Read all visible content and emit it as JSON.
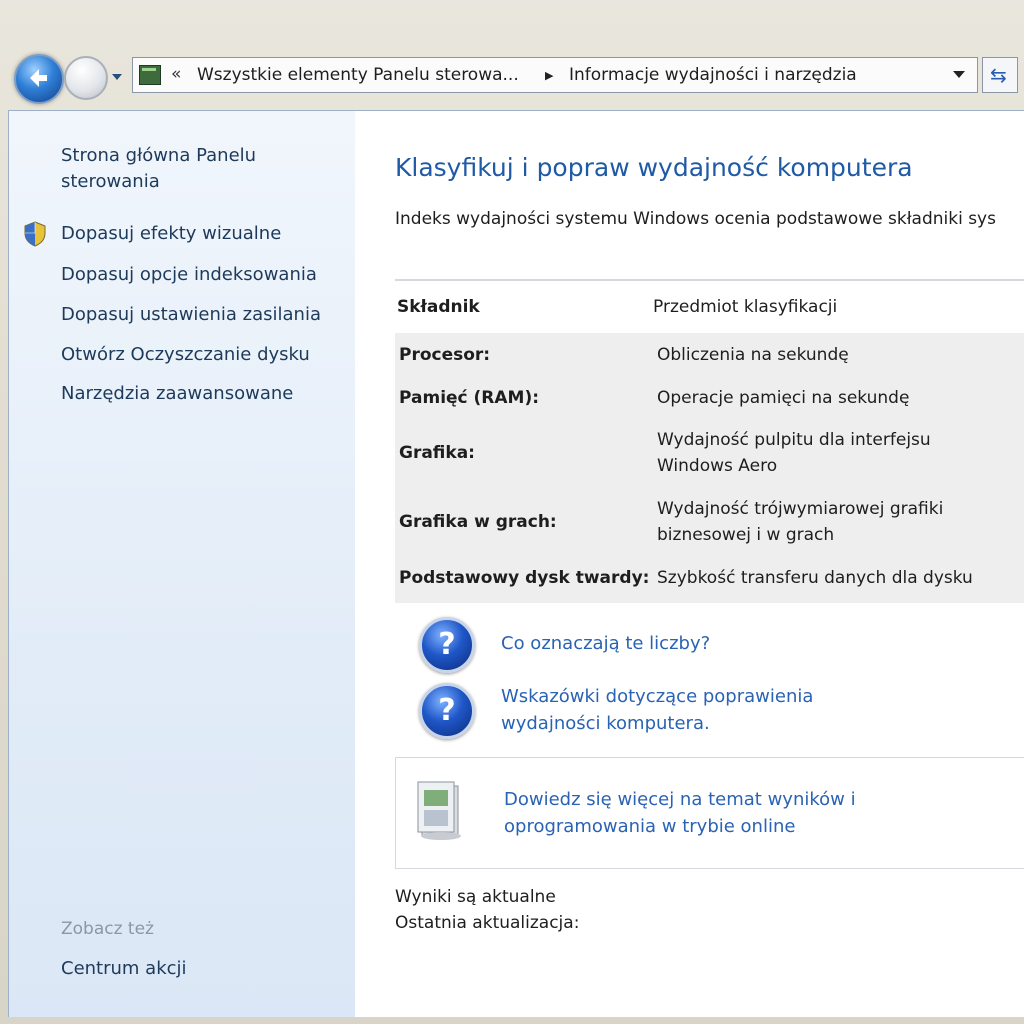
{
  "navbar": {
    "breadcrumb_chevron": "«",
    "breadcrumb_part1": "Wszystkie elementy Panelu sterowa...",
    "breadcrumb_separator": "▶",
    "breadcrumb_part2": "Informacje wydajności i narzędzia",
    "icons": [
      "back-arrow-icon",
      "forward-arrow-icon",
      "recent-pages-icon",
      "control-panel-icon",
      "dropdown-icon",
      "refresh-icon"
    ]
  },
  "sidebar": {
    "home": "Strona główna Panelu sterowania",
    "items": [
      {
        "label": "Dopasuj efekty wizualne",
        "icon": "shield-icon"
      },
      {
        "label": "Dopasuj opcje indeksowania"
      },
      {
        "label": "Dopasuj ustawienia zasilania"
      },
      {
        "label": "Otwórz Oczyszczanie dysku"
      },
      {
        "label": "Narzędzia zaawansowane"
      }
    ],
    "see_also_header": "Zobacz też",
    "see_also_item": "Centrum akcji"
  },
  "main": {
    "title": "Klasyfikuj i popraw wydajność komputera",
    "description": "Indeks wydajności systemu Windows ocenia podstawowe składniki sys",
    "table": {
      "headers": [
        "Składnik",
        "Przedmiot klasyfikacji"
      ],
      "rows": [
        {
          "name": "Procesor:",
          "desc": "Obliczenia na sekundę"
        },
        {
          "name": "Pamięć (RAM):",
          "desc": "Operacje pamięci na sekundę"
        },
        {
          "name": "Grafika:",
          "desc": "Wydajność pulpitu dla interfejsu Windows Aero"
        },
        {
          "name": "Grafika w grach:",
          "desc": "Wydajność trójwymiarowej grafiki biznesowej i w grach"
        },
        {
          "name": "Podstawowy dysk twardy:",
          "desc": "Szybkość transferu danych dla dysku"
        }
      ]
    },
    "help_links": [
      {
        "label": "Co oznaczają te liczby?",
        "icon": "help-icon"
      },
      {
        "label": "Wskazówki dotyczące poprawienia wydajności komputera.",
        "icon": "help-icon"
      }
    ],
    "online_link": "Dowiedz się więcej na temat wyników i oprogramowania w trybie online",
    "status_line1": "Wyniki są aktualne",
    "status_line2": "Ostatnia aktualizacja:"
  },
  "colors": {
    "link": "#2a63b3",
    "title": "#1f5aa6",
    "sidebar_link": "#1e3a5a"
  }
}
